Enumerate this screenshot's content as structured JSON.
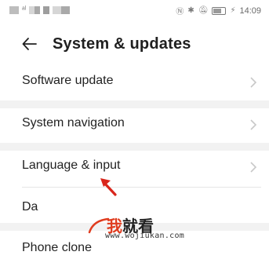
{
  "status_bar": {
    "time": "14:09",
    "battery": "50"
  },
  "header": {
    "title": "System & updates"
  },
  "items": [
    {
      "label": "Software update"
    },
    {
      "label": "System navigation"
    },
    {
      "label": "Language & input"
    },
    {
      "label": "Da"
    },
    {
      "label": "Phone clone"
    }
  ],
  "watermark": {
    "brand_char1": "我",
    "brand_rest": "就看",
    "url": "www.wojiukan.com"
  },
  "colors": {
    "background": "#ffffff",
    "separator": "#f2f2f2",
    "chevron": "#c8c8c8",
    "annotation_arrow": "#d9261c"
  },
  "icons": [
    "back-arrow-icon",
    "chevron-right-icon",
    "nfc-icon",
    "bluetooth-icon",
    "mute-icon",
    "battery-icon",
    "charging-icon"
  ]
}
